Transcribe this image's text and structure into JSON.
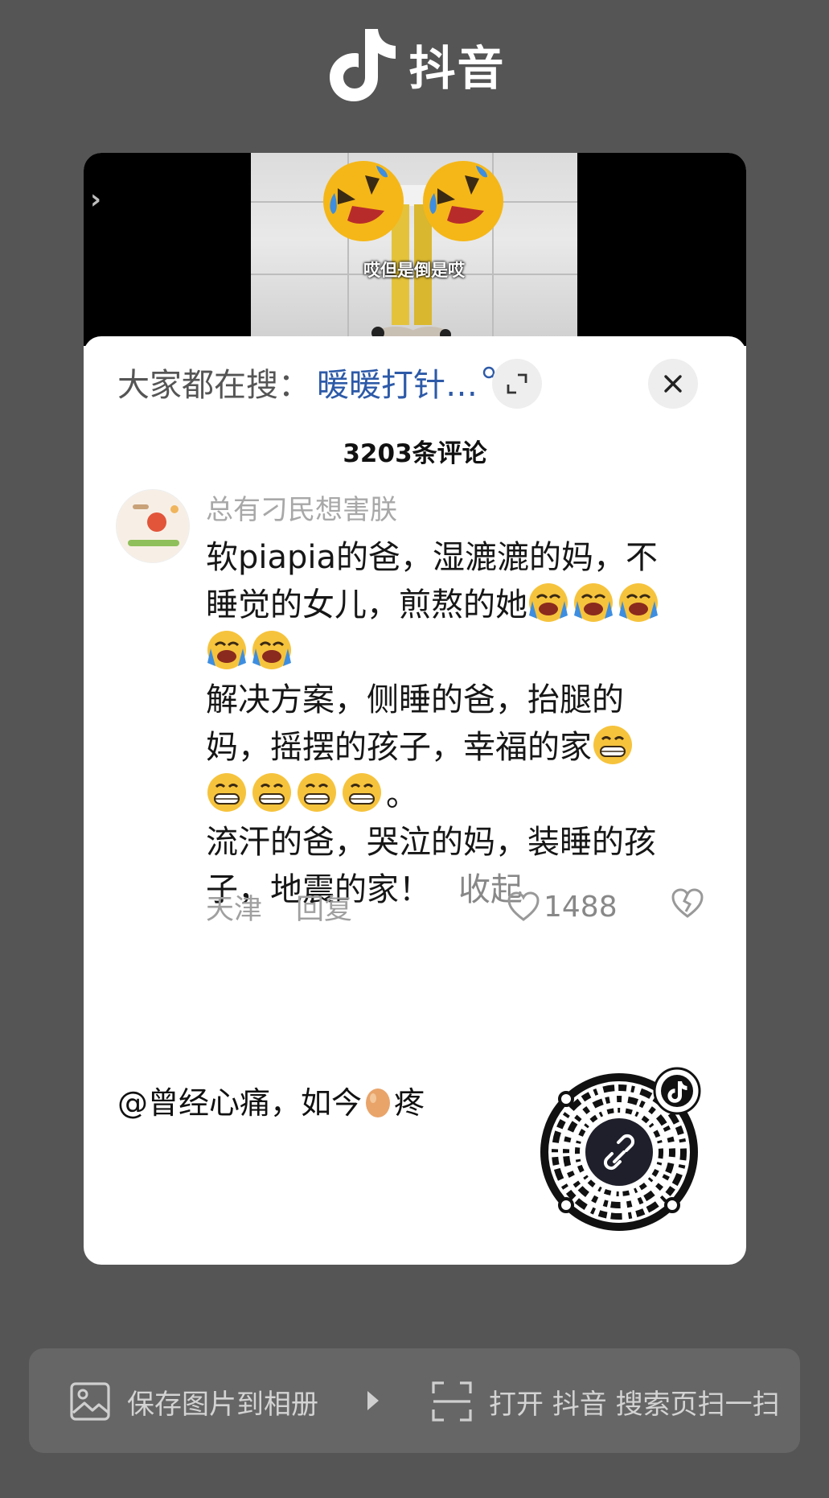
{
  "header": {
    "brand_name": "抖音",
    "logo_icon": "douyin-note-icon"
  },
  "video": {
    "caption": "哎但是倒是哎",
    "emoji_icon": "rolling-laughing-face-icon",
    "nav_icon": "chevron-right-icon"
  },
  "search": {
    "prefix": "大家都在搜：",
    "term": "暖暖打针…",
    "term_icon": "search-icon",
    "expand_icon": "expand-icon",
    "close_icon": "close-icon"
  },
  "comments": {
    "count_label": "3203条评论"
  },
  "comment": {
    "username": "总有刁民想害朕",
    "lines": [
      "软piapia的爸，湿漉漉的妈，不",
      "睡觉的女儿，煎熬的她",
      "",
      "解决方案，侧睡的爸，抬腿的",
      "妈，摇摆的孩子，幸福的家",
      "。",
      "流汗的爸，哭泣的妈，装睡的孩",
      "子，地震的家！"
    ],
    "emojis": {
      "crying_laughing": "loudly-crying-face-icon",
      "grin": "grinning-face-icon"
    },
    "collapse_label": "收起",
    "location": "天津",
    "reply_label": "回复",
    "like_count": "1488",
    "like_icon": "heart-outline-icon",
    "dislike_icon": "broken-heart-icon"
  },
  "share": {
    "author_prefix": "@曾经心痛，如今",
    "author_suffix": "疼",
    "egg_icon": "egg-icon",
    "qr_icon": "qr-code-icon"
  },
  "action_bar": {
    "save_label": "保存图片到相册",
    "save_icon": "image-icon",
    "arrow_icon": "play-right-icon",
    "scan_label": "打开 抖音 搜索页扫一扫",
    "scan_icon": "scan-icon"
  },
  "colors": {
    "page_bg": "#555555",
    "card_bg": "#ffffff",
    "search_term": "#2d5aa8",
    "action_bar_bg": "#666666"
  }
}
